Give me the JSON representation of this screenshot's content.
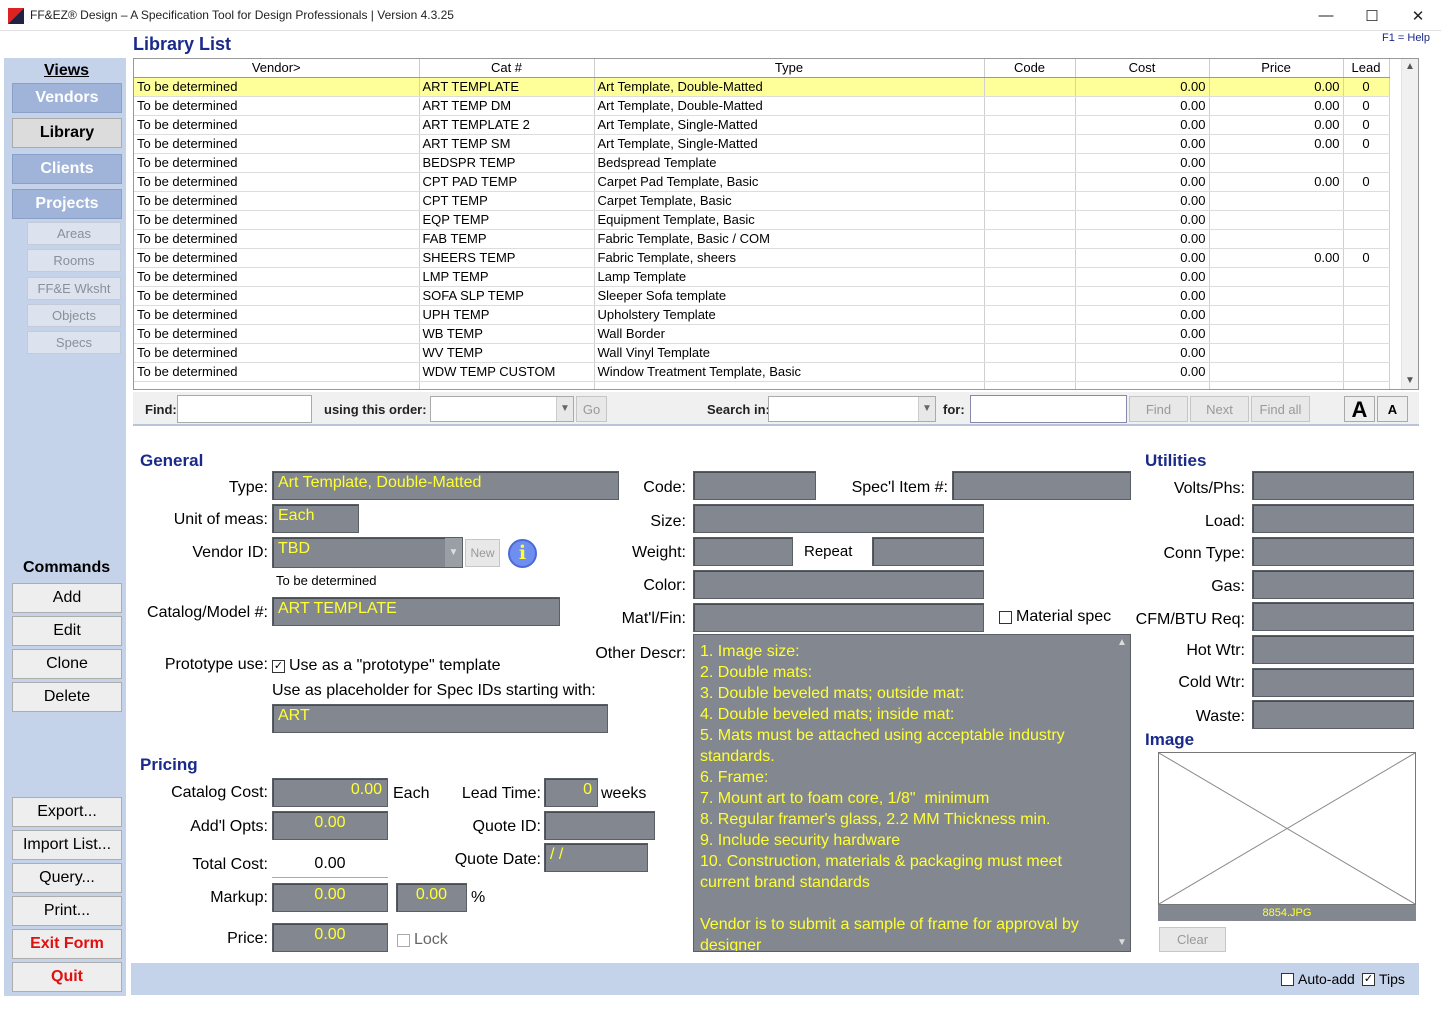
{
  "window": {
    "title": "FF&EZ® Design – A Specification Tool for Design Professionals | Version 4.3.25",
    "min": "—",
    "max": "☐",
    "close": "✕"
  },
  "header": {
    "title": "Library List",
    "help": "F1 = Help"
  },
  "views": {
    "heading": "Views",
    "items": [
      "Vendors",
      "Library",
      "Clients",
      "Projects"
    ],
    "sub": [
      "Areas",
      "Rooms",
      "FF&E Wksht",
      "Objects",
      "Specs"
    ]
  },
  "commands": {
    "heading": "Commands",
    "items": [
      "Add",
      "Edit",
      "Clone",
      "Delete"
    ],
    "io": [
      "Export...",
      "Import List...",
      "Query...",
      "Print..."
    ],
    "exit": "Exit Form",
    "quit": "Quit"
  },
  "grid": {
    "columns": [
      "Vendor>",
      "Cat #",
      "Type",
      "Code",
      "Cost",
      "Price",
      "Lead"
    ],
    "rows": [
      [
        "To be determined",
        "ART TEMPLATE",
        "Art Template, Double-Matted",
        "",
        "0.00",
        "0.00",
        "0"
      ],
      [
        "To be determined",
        "ART TEMP DM",
        "Art Template, Double-Matted",
        "",
        "0.00",
        "0.00",
        "0"
      ],
      [
        "To be determined",
        "ART TEMPLATE 2",
        "Art Template, Single-Matted",
        "",
        "0.00",
        "0.00",
        "0"
      ],
      [
        "To be determined",
        "ART TEMP SM",
        "Art Template, Single-Matted",
        "",
        "0.00",
        "0.00",
        "0"
      ],
      [
        "To be determined",
        "BEDSPR TEMP",
        "Bedspread Template",
        "",
        "0.00",
        "",
        ""
      ],
      [
        "To be determined",
        "CPT PAD TEMP",
        "Carpet Pad Template, Basic",
        "",
        "0.00",
        "0.00",
        "0"
      ],
      [
        "To be determined",
        "CPT TEMP",
        "Carpet Template, Basic",
        "",
        "0.00",
        "",
        ""
      ],
      [
        "To be determined",
        "EQP TEMP",
        "Equipment Template, Basic",
        "",
        "0.00",
        "",
        ""
      ],
      [
        "To be determined",
        "FAB TEMP",
        "Fabric Template, Basic / COM",
        "",
        "0.00",
        "",
        ""
      ],
      [
        "To be determined",
        "SHEERS TEMP",
        "Fabric Template, sheers",
        "",
        "0.00",
        "0.00",
        "0"
      ],
      [
        "To be determined",
        "LMP TEMP",
        "Lamp Template",
        "",
        "0.00",
        "",
        ""
      ],
      [
        "To be determined",
        "SOFA SLP TEMP",
        "Sleeper Sofa template",
        "",
        "0.00",
        "",
        ""
      ],
      [
        "To be determined",
        "UPH TEMP",
        "Upholstery Template",
        "",
        "0.00",
        "",
        ""
      ],
      [
        "To be determined",
        "WB TEMP",
        "Wall Border",
        "",
        "0.00",
        "",
        ""
      ],
      [
        "To be determined",
        "WV TEMP",
        "Wall Vinyl Template",
        "",
        "0.00",
        "",
        ""
      ],
      [
        "To be determined",
        "WDW TEMP CUSTOM",
        "Window Treatment Template, Basic",
        "",
        "0.00",
        "",
        ""
      ]
    ]
  },
  "find": {
    "find_label": "Find:",
    "order_label": "using this order:",
    "go": "Go",
    "search_label": "Search in:",
    "for_label": "for:",
    "find_btn": "Find",
    "next_btn": "Next",
    "findall_btn": "Find all",
    "big_a": "A",
    "small_a": "A"
  },
  "general": {
    "heading": "General",
    "type_label": "Type:",
    "type": "Art Template, Double-Matted",
    "unit_label": "Unit of meas:",
    "unit": "Each",
    "vendor_label": "Vendor ID:",
    "vendor": "TBD",
    "new_btn": "New",
    "vendor_name": "To be determined",
    "catalog_label": "Catalog/Model #:",
    "catalog": "ART TEMPLATE",
    "proto_label": "Prototype use:",
    "proto_check": "Use as a \"prototype\" template",
    "placeholder_label": "Use as placeholder for Spec IDs starting with:",
    "placeholder": "ART"
  },
  "specs": {
    "code_label": "Code:",
    "specl_label": "Spec'l Item #:",
    "size_label": "Size:",
    "weight_label": "Weight:",
    "repeat_label": "Repeat",
    "color_label": "Color:",
    "matl_label": "Mat'l/Fin:",
    "matspec_label": "Material spec",
    "other_label": "Other Descr:"
  },
  "descr": "1. Image size:\n2. Double mats:\n3. Double beveled mats; outside mat:\n4. Double beveled mats; inside mat:\n5. Mats must be attached using acceptable industry standards.\n6. Frame:\n7. Mount art to foam core, 1/8\"  minimum\n8. Regular framer's glass, 2.2 MM Thickness min.\n9. Include security hardware\n10. Construction, materials & packaging must meet current brand standards\n\nVendor is to submit a sample of frame for approval by designer",
  "pricing": {
    "heading": "Pricing",
    "catcost_label": "Catalog Cost:",
    "catcost": "0.00",
    "each": "Each",
    "lead_label": "Lead Time:",
    "lead": "0",
    "weeks": "weeks",
    "addl_label": "Add'l Opts:",
    "addl": "0.00",
    "quote_label": "Quote ID:",
    "total_label": "Total Cost:",
    "total": "0.00",
    "qdate_label": "Quote Date:",
    "qdate": "  /  /",
    "markup_label": "Markup:",
    "markup": "0.00",
    "markup_pct": "0.00",
    "pct": "%",
    "price_label": "Price:",
    "price": "0.00",
    "lock": "Lock"
  },
  "utilities": {
    "heading": "Utilities",
    "labels": [
      "Volts/Phs:",
      "Load:",
      "Conn Type:",
      "Gas:",
      "CFM/BTU Req:",
      "Hot Wtr:",
      "Cold Wtr:",
      "Waste:"
    ]
  },
  "image": {
    "heading": "Image",
    "filename": "8854.JPG",
    "clear": "Clear"
  },
  "status": {
    "autoadd": "Auto-add",
    "tips": "Tips"
  }
}
